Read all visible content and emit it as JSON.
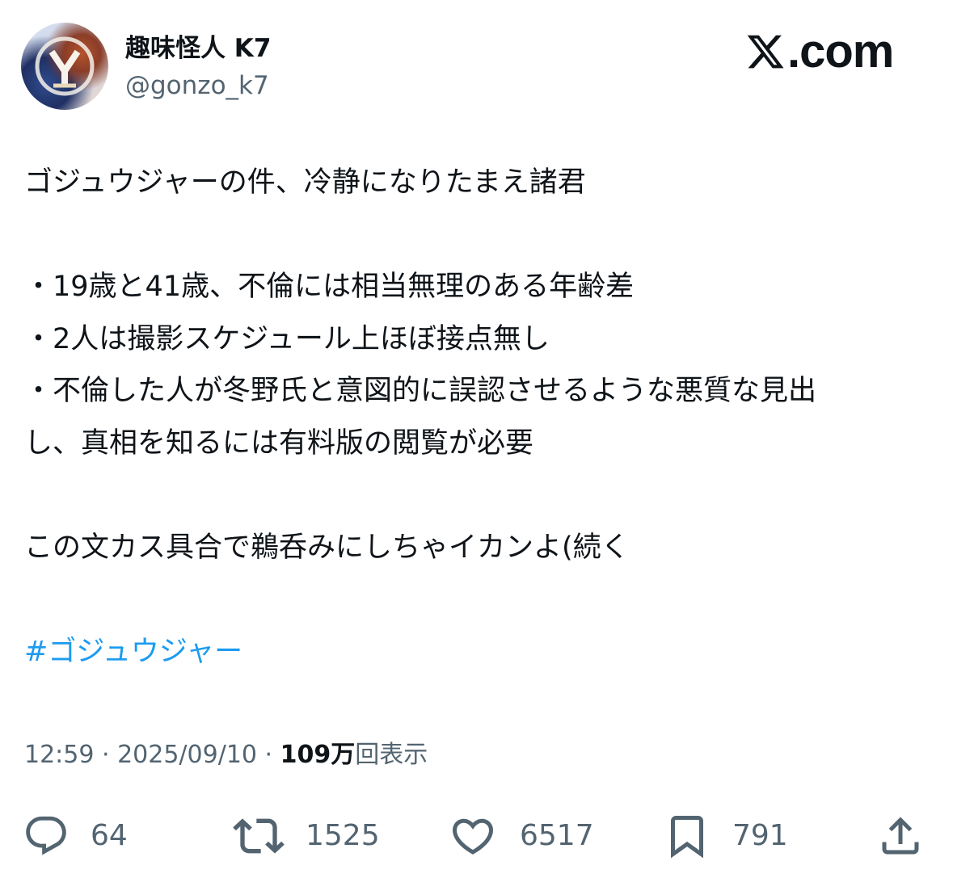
{
  "author": {
    "display_name": "趣味怪人 K7",
    "handle": "@gonzo_k7"
  },
  "brand": {
    "domain": "X.com",
    "domain_suffix": ".com"
  },
  "tweet": {
    "lines": [
      "ゴジュウジャーの件、冷静になりたまえ諸君",
      "",
      "・19歳と41歳、不倫には相当無理のある年齢差",
      "・2人は撮影スケジュール上ほぼ接点無し",
      "・不倫した人が冬野氏と意図的に誤認させるような悪質な見出",
      "し、真相を知るには有料版の閲覧が必要",
      "",
      "この文カス具合で鵜呑みにしちゃイカンよ(続く",
      ""
    ],
    "hashtag": "#ゴジュウジャー"
  },
  "meta": {
    "time": "12:59",
    "separator": " · ",
    "date": "2025/09/10",
    "views_count": "109",
    "views_unit": "万",
    "views_label": "回表示"
  },
  "actions": {
    "reply_count": "64",
    "repost_count": "1525",
    "like_count": "6517",
    "bookmark_count": "791"
  },
  "colors": {
    "text": "#0f1419",
    "secondary": "#536471",
    "link": "#1d9bf0"
  }
}
